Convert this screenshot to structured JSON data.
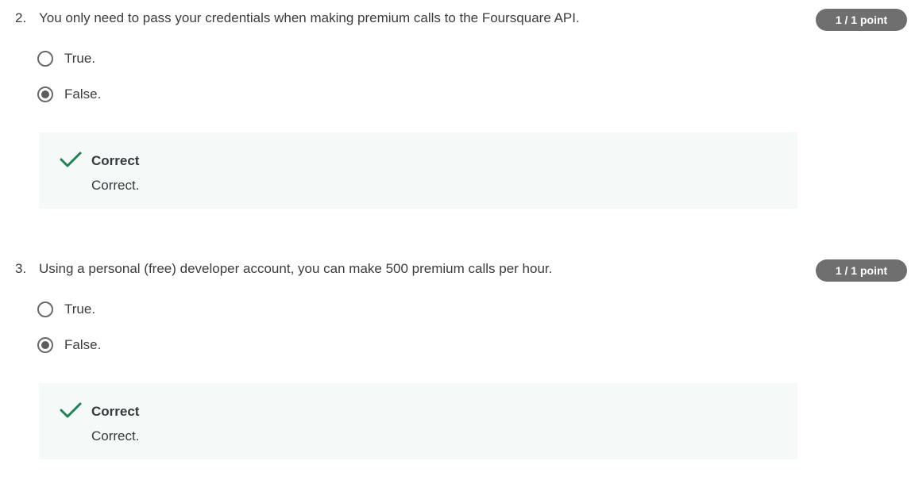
{
  "questions": [
    {
      "number": "2.",
      "text": "You only need to pass your credentials when making premium calls to the Foursquare API.",
      "points": "1 / 1 point",
      "options": [
        {
          "label": "True.",
          "selected": false
        },
        {
          "label": "False.",
          "selected": true
        }
      ],
      "feedback": {
        "title": "Correct",
        "text": "Correct."
      }
    },
    {
      "number": "3.",
      "text": "Using a personal (free) developer account, you can make 500 premium calls per hour.",
      "points": "1 / 1 point",
      "options": [
        {
          "label": "True.",
          "selected": false
        },
        {
          "label": "False.",
          "selected": true
        }
      ],
      "feedback": {
        "title": "Correct",
        "text": "Correct."
      }
    }
  ],
  "colors": {
    "badge": "#6f6f6f",
    "check": "#1f8354",
    "feedback_bg": "#f5f9f7"
  }
}
